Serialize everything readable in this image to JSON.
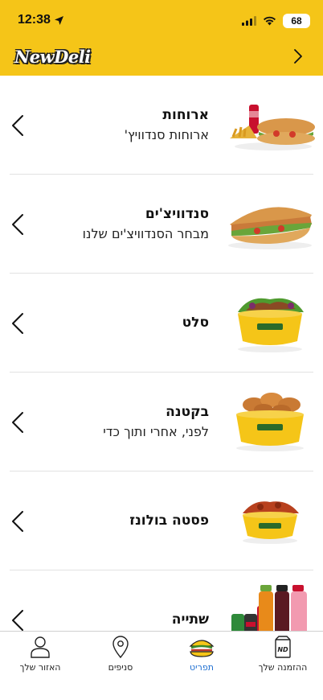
{
  "status_bar": {
    "time": "12:38",
    "battery": "68"
  },
  "header": {
    "logo": "NewDeli"
  },
  "menu": [
    {
      "title": "ארוחות",
      "subtitle": "ארוחות סנדוויץ'",
      "image": "meal-combo-image"
    },
    {
      "title": "סנדוויצ'ים",
      "subtitle": "מבחר הסנדוויצ'ים שלנו",
      "image": "sandwich-image"
    },
    {
      "title": "סלט",
      "subtitle": "",
      "image": "salad-bowl-image"
    },
    {
      "title": "בקטנה",
      "subtitle": "לפני, אחרי ותוך כדי",
      "image": "chicken-wings-bowl-image"
    },
    {
      "title": "פסטה בולונז",
      "subtitle": "",
      "image": "pasta-bowl-image"
    },
    {
      "title": "שתייה",
      "subtitle": "",
      "image": "drinks-image"
    }
  ],
  "tabs": {
    "orders": "ההזמנה שלך",
    "menu": "תפריט",
    "branches": "סניפים",
    "account": "האזור שלך"
  },
  "colors": {
    "brand_yellow": "#f5c518",
    "active_tab": "#1f6fd1"
  }
}
